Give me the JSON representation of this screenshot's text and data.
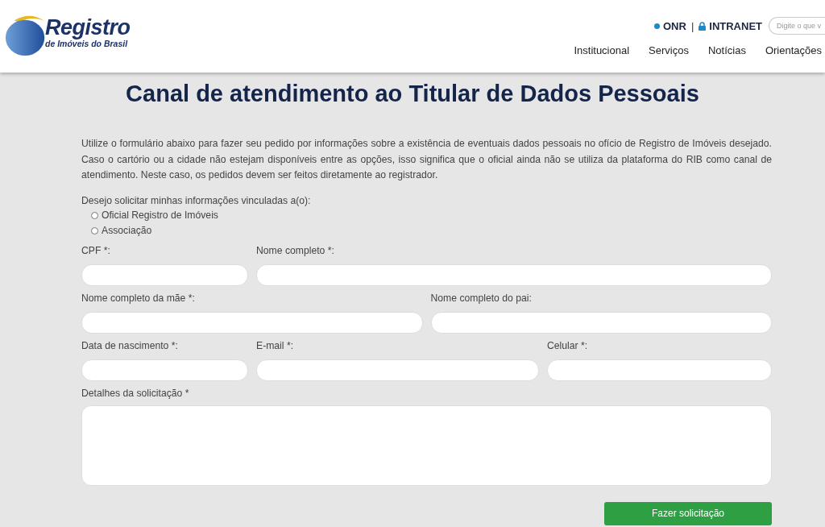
{
  "header": {
    "logo": {
      "title": "Registro",
      "subtitle": "de Imóveis do Brasil"
    },
    "top_links": [
      {
        "kind": "dot",
        "label": "ONR"
      },
      {
        "kind": "lock",
        "label": "INTRANET"
      }
    ],
    "separator": "|",
    "search": {
      "placeholder": "Digite o que v"
    },
    "nav": [
      "Institucional",
      "Serviços",
      "Notícias",
      "Orientações"
    ]
  },
  "title": "Canal de atendimento ao Titular de Dados Pessoais",
  "intro": "Utilize o formulário abaixo para fazer seu pedido por informações sobre a existência de eventuais dados pessoais no ofício de Registro de Imóveis desejado. Caso o cartório ou a cidade não estejam disponíveis entre as opções, isso significa que o oficial ainda não se utiliza da plataforma do RIB como canal de atendimento. Neste caso, os pedidos devem ser feitos diretamente ao registrador.",
  "choice": {
    "label": "Desejo solicitar minhas informações vinculadas a(o):",
    "options": [
      {
        "label": "Oficial Registro de Imóveis",
        "selected": false
      },
      {
        "label": "Associação",
        "selected": false
      }
    ]
  },
  "rows": [
    [
      {
        "label": "CPF *:"
      },
      {
        "label": "Nome completo *:"
      }
    ],
    [
      {
        "label": "Nome completo da mãe *:"
      },
      {
        "label": "Nome completo do pai:"
      }
    ],
    [
      {
        "label": "Data de nascimento *:"
      },
      {
        "label": "E-mail *:"
      },
      {
        "label": "Celular *:"
      }
    ]
  ],
  "details": {
    "label": "Detalhes da solicitação *"
  },
  "submit": "Fazer solicitação"
}
